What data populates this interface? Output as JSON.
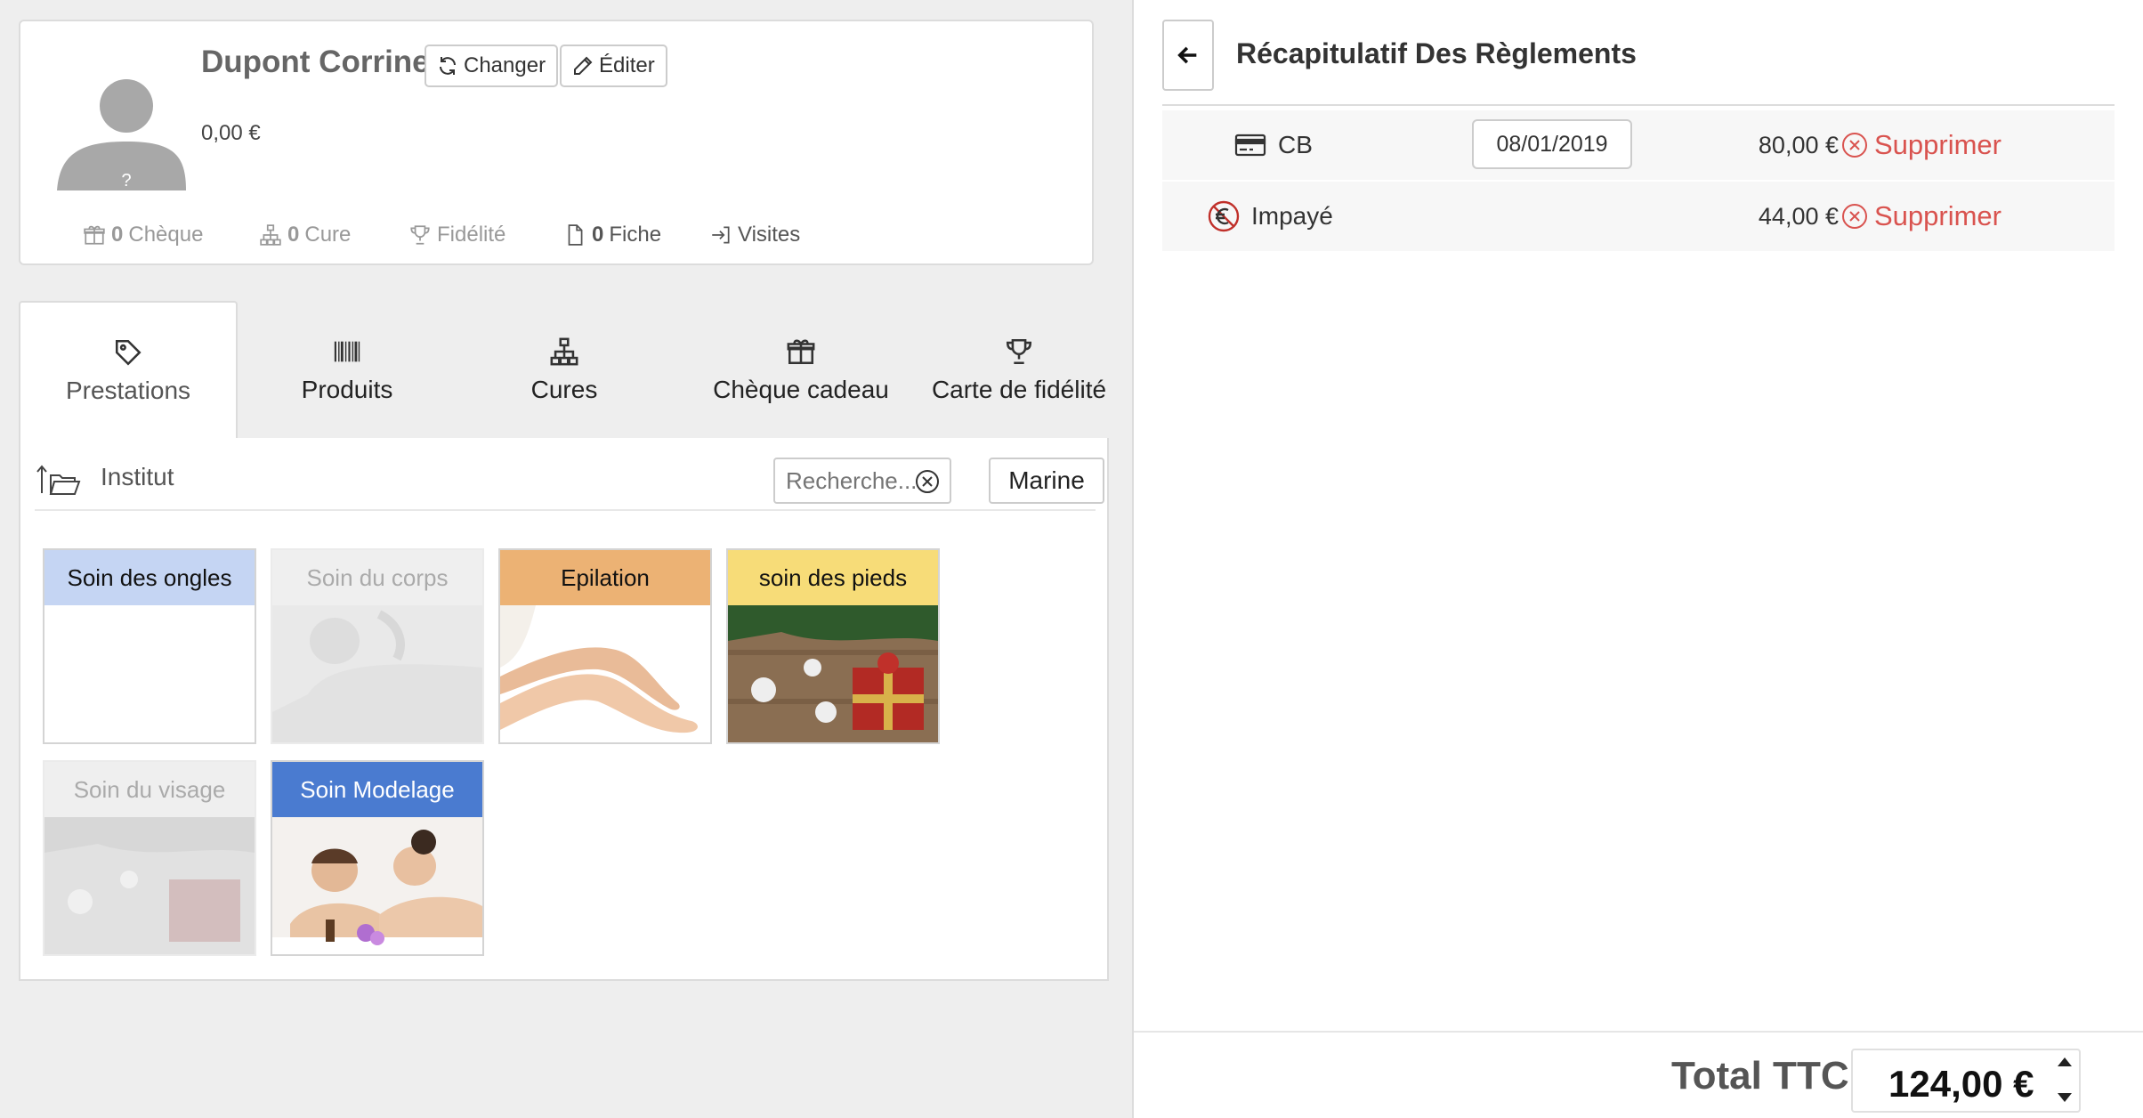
{
  "client": {
    "name": "Dupont Corrine",
    "balance": "0,00 €",
    "change_label": "Changer",
    "edit_label": "Éditer",
    "avatar_mark": "?",
    "stats": {
      "cheque_count": "0",
      "cheque_label": "Chèque",
      "cure_count": "0",
      "cure_label": "Cure",
      "fidelite_label": "Fidélité",
      "fiche_count": "0",
      "fiche_label": "Fiche",
      "visites_label": "Visites"
    }
  },
  "tabs": [
    {
      "label": "Prestations",
      "icon": "tag-icon",
      "active": true
    },
    {
      "label": "Produits",
      "icon": "barcode-icon",
      "active": false
    },
    {
      "label": "Cures",
      "icon": "sitemap-icon",
      "active": false
    },
    {
      "label": "Chèque cadeau",
      "icon": "gift-icon",
      "active": false
    },
    {
      "label": "Carte de fidélité",
      "icon": "trophy-icon",
      "active": false
    }
  ],
  "catalog": {
    "folder": "Institut",
    "search_placeholder": "Recherche...",
    "staff_button": "Marine",
    "categories": [
      {
        "label": "Soin des ongles",
        "color": "#c5d5f3",
        "enabled": true
      },
      {
        "label": "Soin du corps",
        "color": "#dddddd",
        "enabled": false
      },
      {
        "label": "Epilation",
        "color": "#ecb274",
        "enabled": true
      },
      {
        "label": "soin des pieds",
        "color": "#f7dc78",
        "enabled": true
      },
      {
        "label": "Soin du visage",
        "color": "#dddddd",
        "enabled": false
      },
      {
        "label": "Soin Modelage",
        "color": "#4a7bd0",
        "enabled": true
      }
    ]
  },
  "recap": {
    "title": "Récapitulatif Des Règlements",
    "payments": [
      {
        "type": "CB",
        "icon": "credit-card-icon",
        "date": "08/01/2019",
        "amount": "80,00 €",
        "delete_label": "Supprimer"
      },
      {
        "type": "Impayé",
        "icon": "no-euro-icon",
        "date": "",
        "amount": "44,00 €",
        "delete_label": "Supprimer"
      }
    ],
    "total_label": "Total TTC",
    "total_value": "124,00 €"
  },
  "colors": {
    "danger": "#d9534f",
    "panel_bg": "#eeeeee",
    "border": "#dcdcdc"
  }
}
